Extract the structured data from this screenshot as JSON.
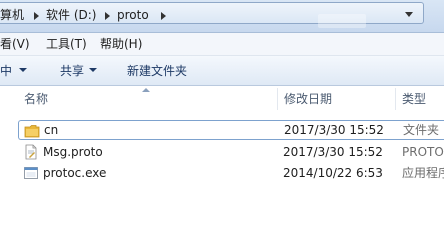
{
  "address_bar": {
    "crumbs": [
      "算机",
      "软件 (D:)",
      "proto"
    ]
  },
  "menu": {
    "items": [
      "看(V)",
      "工具(T)",
      "帮助(H)"
    ]
  },
  "toolbar": {
    "organize_label": "库中",
    "share_label": "共享",
    "new_folder_label": "新建文件夹"
  },
  "columns": {
    "name": "名称",
    "modified": "修改日期",
    "type": "类型"
  },
  "files": [
    {
      "name": "cn",
      "modified": "2017/3/30 15:52",
      "type": "文件夹",
      "icon": "folder-icon"
    },
    {
      "name": "Msg.proto",
      "modified": "2017/3/30 15:52",
      "type": "PROTO",
      "icon": "proto-file-icon"
    },
    {
      "name": "protoc.exe",
      "modified": "2014/10/22 6:53",
      "type": "应用程序",
      "icon": "exe-file-icon"
    }
  ],
  "colors": {
    "accent": "#7da2ce",
    "folder": "#e8b73a"
  }
}
